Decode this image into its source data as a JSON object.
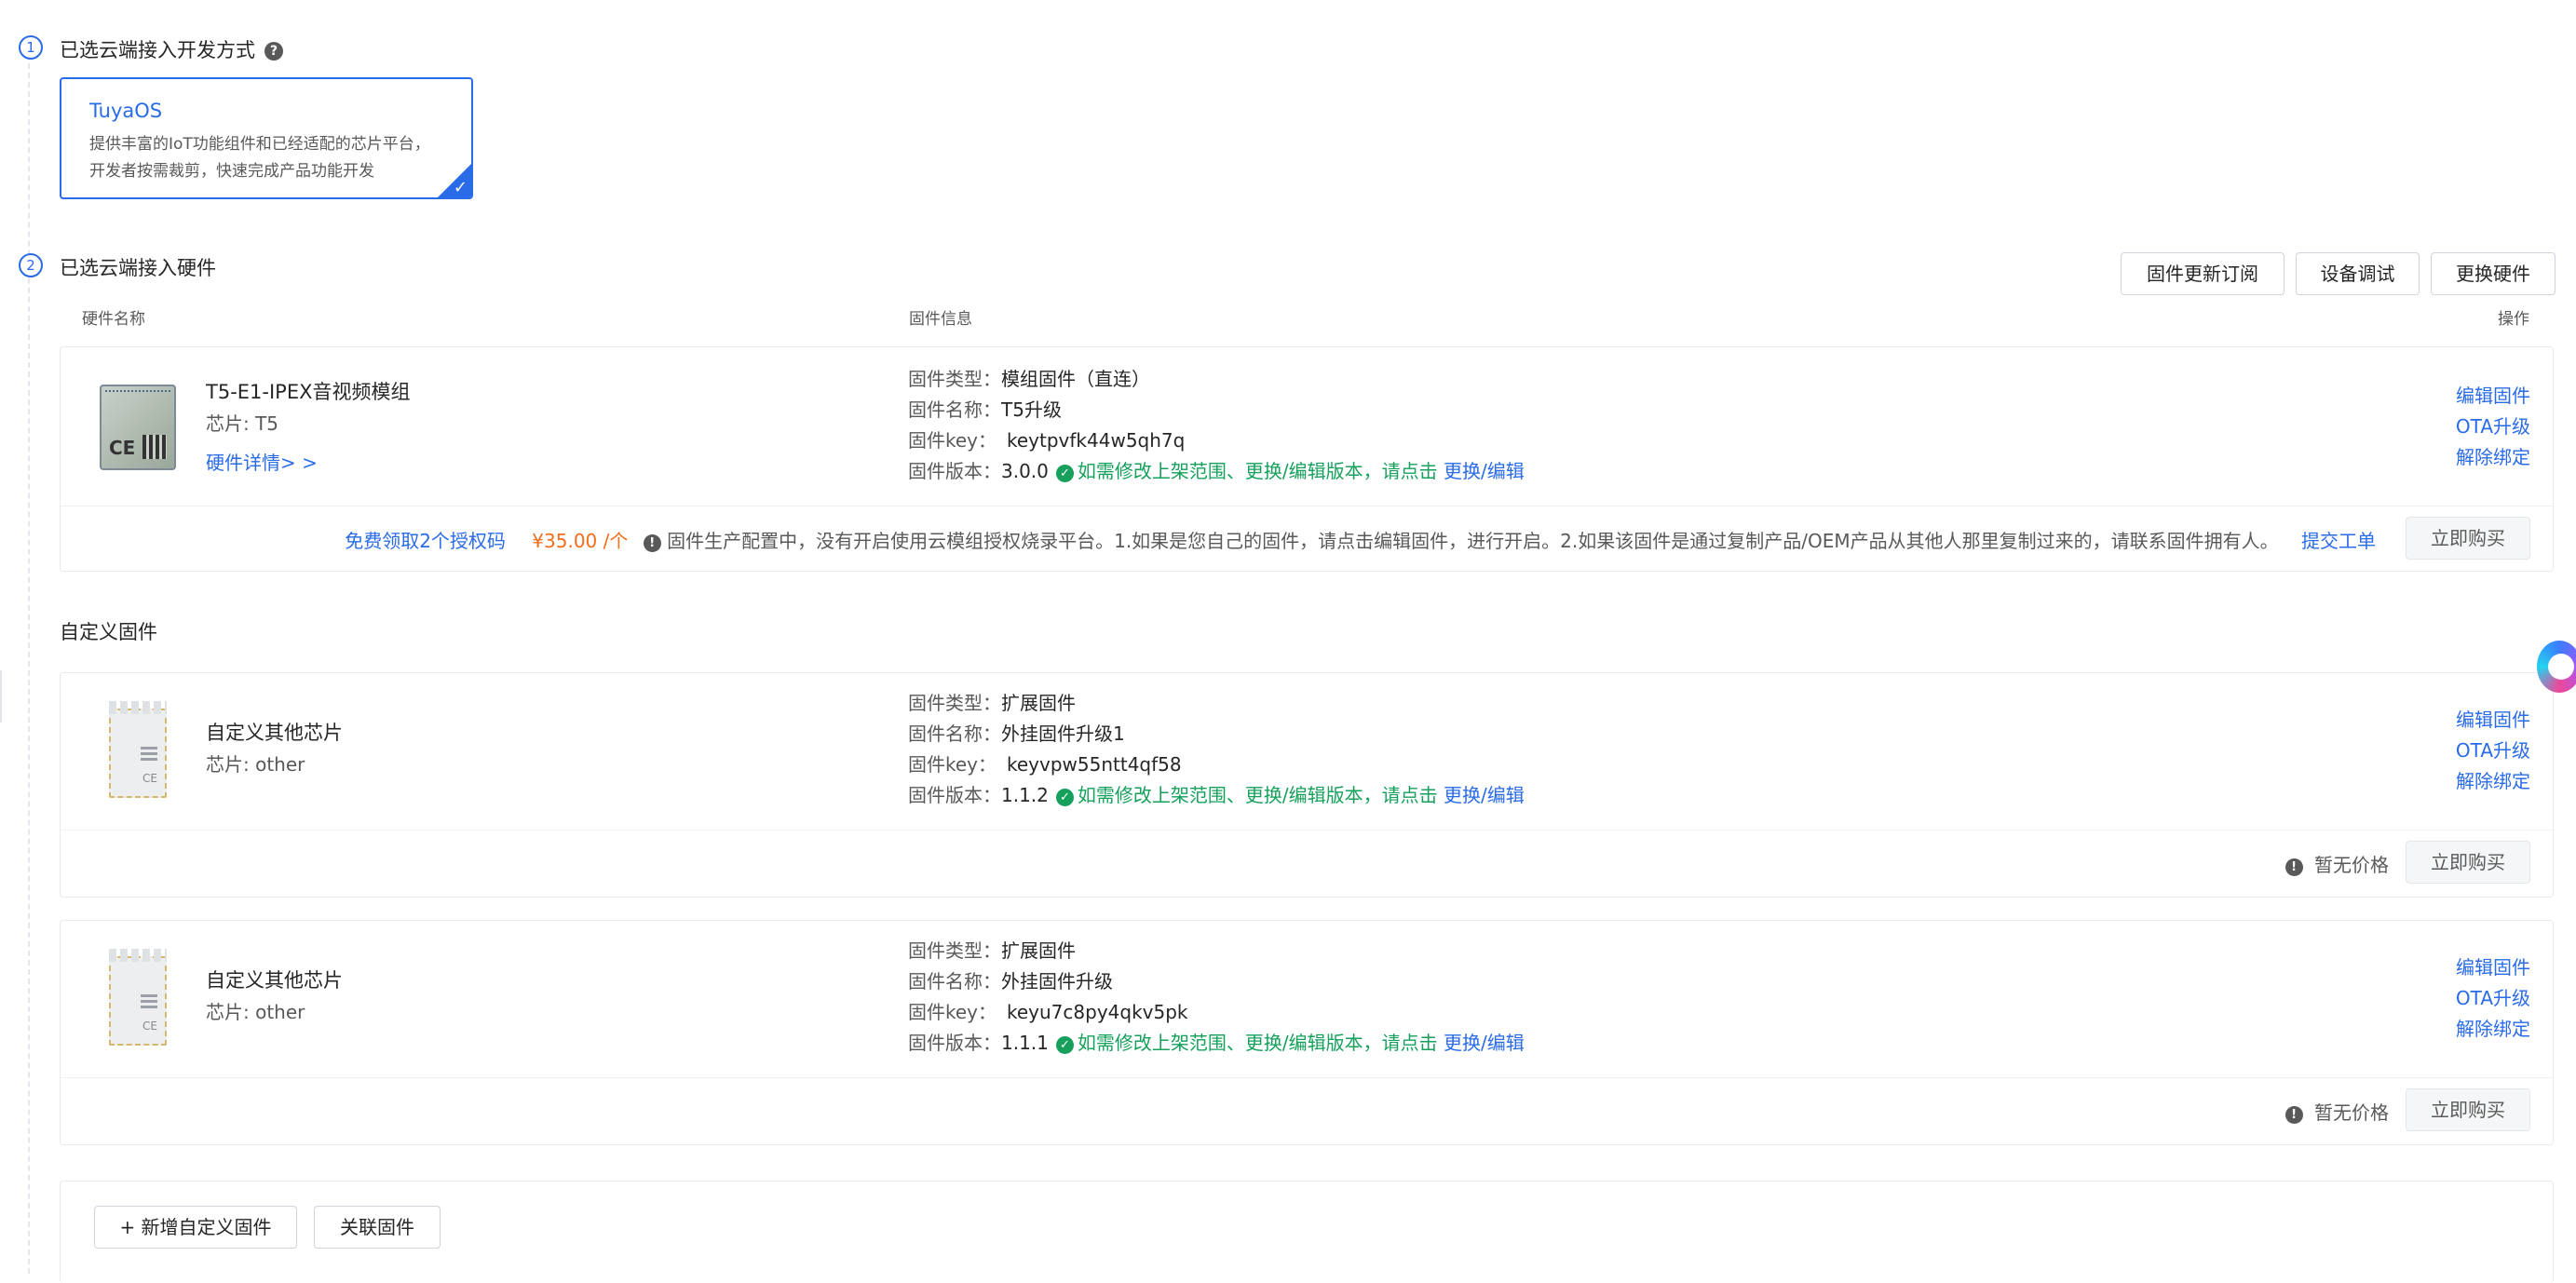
{
  "step1": {
    "number": "①",
    "title": "已选云端接入开发方式",
    "help_icon": "question-icon"
  },
  "os_card": {
    "name": "TuyaOS",
    "description": "提供丰富的IoT功能组件和已经适配的芯片平台，开发者按需裁剪，快速完成产品功能开发",
    "selected_icon": "check-icon"
  },
  "step2": {
    "number": "②",
    "title": "已选云端接入硬件"
  },
  "toolbar": {
    "subscribe": "固件更新订阅",
    "debug": "设备调试",
    "replace": "更换硬件"
  },
  "columns": {
    "hardware": "硬件名称",
    "firmware": "固件信息",
    "ops": "操作"
  },
  "labels": {
    "fw_type": "固件类型：",
    "fw_name": "固件名称：",
    "fw_key": "固件key：",
    "fw_version": "固件版本：",
    "version_tip": "如需修改上架范围、更换/编辑版本，请点击",
    "version_link": "更换/编辑",
    "edit": "编辑固件",
    "ota": "OTA升级",
    "unbind": "解除绑定",
    "buy": "立即购买",
    "no_price": "暂无价格"
  },
  "main_hw": {
    "name": "T5-E1-IPEX音视频模组",
    "chip": "芯片: T5",
    "detail_link": "硬件详情> >",
    "fw_type": "模组固件（直连）",
    "fw_name": "T5升级",
    "fw_key": "keytpvfk44w5qh7q",
    "fw_version": "3.0.0",
    "free_auth": "免费领取2个授权码",
    "price": "¥35.00 /个",
    "notice": "固件生产配置中，没有开启使用云模组授权烧录平台。1.如果是您自己的固件，请点击编辑固件，进行开启。2.如果该固件是通过复制产品/OEM产品从其他人那里复制过来的，请联系固件拥有人。",
    "ticket_link": "提交工单"
  },
  "custom_section": {
    "title": "自定义固件"
  },
  "custom_firmwares": [
    {
      "name": "自定义其他芯片",
      "chip": "芯片: other",
      "fw_type": "扩展固件",
      "fw_name": "外挂固件升级1",
      "fw_key": "keyvpw55ntt4qf58",
      "fw_version": "1.1.2"
    },
    {
      "name": "自定义其他芯片",
      "chip": "芯片: other",
      "fw_type": "扩展固件",
      "fw_name": "外挂固件升级",
      "fw_key": "keyu7c8py4qkv5pk",
      "fw_version": "1.1.1"
    }
  ],
  "bottom": {
    "add_custom": "+ 新增自定义固件",
    "link_fw": "关联固件"
  },
  "colors": {
    "primary": "#2a6be8",
    "success": "#16a05c",
    "price": "#f56c1a"
  }
}
